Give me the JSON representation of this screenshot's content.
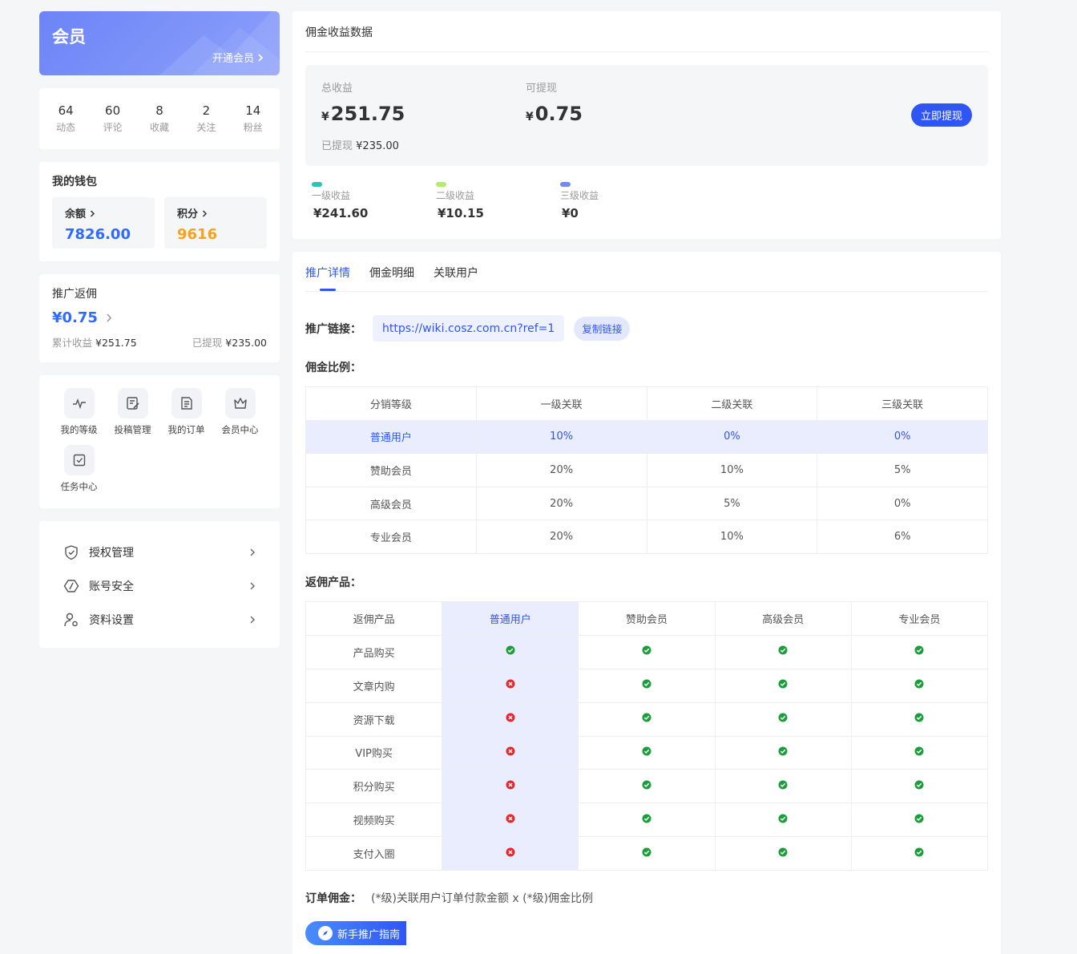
{
  "member": {
    "title": "会员",
    "open_label": "开通会员"
  },
  "stats": [
    {
      "num": "64",
      "label": "动态"
    },
    {
      "num": "60",
      "label": "评论"
    },
    {
      "num": "8",
      "label": "收藏"
    },
    {
      "num": "2",
      "label": "关注"
    },
    {
      "num": "14",
      "label": "粉丝"
    }
  ],
  "wallet": {
    "title": "我的钱包",
    "balance_label": "余额",
    "balance_value": "7826.00",
    "points_label": "积分",
    "points_value": "9616",
    "colors": {
      "balance": "#2f6bff",
      "points": "#f7a21b"
    }
  },
  "promo": {
    "title": "推广返佣",
    "amount": "¥0.75",
    "total_label": "累计收益",
    "total_value": "¥251.75",
    "withdrawn_label": "已提现",
    "withdrawn_value": "¥235.00"
  },
  "quick": [
    {
      "label": "我的等级",
      "icon": "pulse-icon"
    },
    {
      "label": "投稿管理",
      "icon": "edit-doc-icon"
    },
    {
      "label": "我的订单",
      "icon": "order-doc-icon"
    },
    {
      "label": "会员中心",
      "icon": "crown-icon"
    },
    {
      "label": "任务中心",
      "icon": "checkbox-icon"
    }
  ],
  "menu": [
    {
      "label": "授权管理",
      "icon": "shield-check-icon"
    },
    {
      "label": "账号安全",
      "icon": "hexagon-slash-icon"
    },
    {
      "label": "资料设置",
      "icon": "user-gear-icon"
    }
  ],
  "earn": {
    "title": "佣金收益数据",
    "total_label": "总收益",
    "total_value": "251.75",
    "withdrawable_label": "可提现",
    "withdrawable_value": "0.75",
    "currency": "¥",
    "withdrawn_label": "已提现",
    "withdrawn_value": "¥235.00",
    "withdraw_btn": "立即提现",
    "levels": [
      {
        "label": "一级收益",
        "value": "¥241.60",
        "color": "#22c5b8"
      },
      {
        "label": "二级收益",
        "value": "¥10.15",
        "color": "#b6ea6a"
      },
      {
        "label": "三级收益",
        "value": "¥0",
        "color": "#6f8cf6"
      }
    ]
  },
  "tabs": [
    "推广详情",
    "佣金明细",
    "关联用户"
  ],
  "promo_link": {
    "label": "推广链接：",
    "url": "https://wiki.cosz.com.cn?ref=1",
    "copy_label": "复制链接"
  },
  "ratio": {
    "title": "佣金比例：",
    "headers": [
      "分销等级",
      "一级关联",
      "二级关联",
      "三级关联"
    ],
    "rows": [
      [
        "普通用户",
        "10%",
        "0%",
        "0%"
      ],
      [
        "赞助会员",
        "20%",
        "10%",
        "5%"
      ],
      [
        "高级会员",
        "20%",
        "5%",
        "0%"
      ],
      [
        "专业会员",
        "20%",
        "10%",
        "6%"
      ]
    ]
  },
  "products": {
    "title": "返佣产品：",
    "headers": [
      "返佣产品",
      "普通用户",
      "赞助会员",
      "高级会员",
      "专业会员"
    ],
    "rows": [
      {
        "name": "产品购买",
        "flags": [
          true,
          true,
          true,
          true
        ]
      },
      {
        "name": "文章内购",
        "flags": [
          false,
          true,
          true,
          true
        ]
      },
      {
        "name": "资源下载",
        "flags": [
          false,
          true,
          true,
          true
        ]
      },
      {
        "name": "VIP购买",
        "flags": [
          false,
          true,
          true,
          true
        ]
      },
      {
        "name": "积分购买",
        "flags": [
          false,
          true,
          true,
          true
        ]
      },
      {
        "name": "视频购买",
        "flags": [
          false,
          true,
          true,
          true
        ]
      },
      {
        "name": "支付入圈",
        "flags": [
          false,
          true,
          true,
          true
        ]
      }
    ]
  },
  "formula": {
    "label": "订单佣金：",
    "value": "(*级)关联用户订单付款金额 x (*级)佣金比例"
  },
  "guide_btn": "新手推广指南"
}
